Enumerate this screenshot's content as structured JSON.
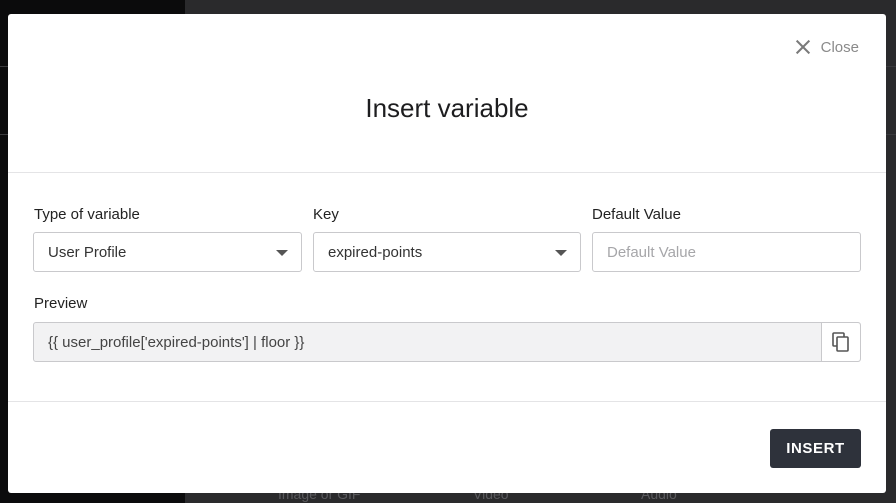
{
  "background": {
    "footer_items": [
      "Image or GIF",
      "Video",
      "Audio"
    ]
  },
  "modal": {
    "close_label": "Close",
    "title": "Insert variable",
    "type_label": "Type of variable",
    "type_value": "User Profile",
    "key_label": "Key",
    "key_value": "expired-points",
    "default_label": "Default Value",
    "default_placeholder": "Default Value",
    "default_value": "",
    "preview_label": "Preview",
    "preview_value": "{{ user_profile['expired-points'] | floor }}",
    "insert_label": "INSERT"
  },
  "icons": {
    "close": "close-icon",
    "dropdown": "caret-down-icon",
    "copy": "copy-icon"
  },
  "colors": {
    "primary_button": "#2e323b",
    "preview_bg": "#f2f2f3"
  }
}
